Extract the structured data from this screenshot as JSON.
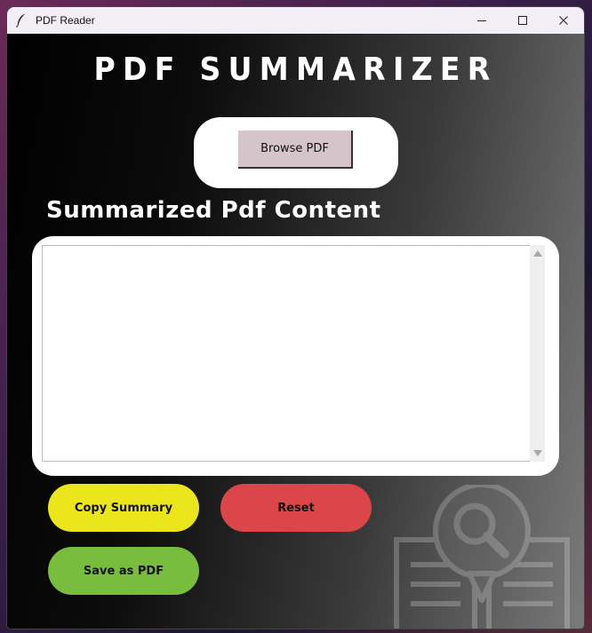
{
  "window": {
    "title": "PDF Reader",
    "app_icon": "feather-icon",
    "controls": [
      "minimize-icon",
      "maximize-icon",
      "close-icon"
    ]
  },
  "header": {
    "title": "PDF SUMMARIZER"
  },
  "browse": {
    "label": "Browse PDF"
  },
  "summary": {
    "heading": "Summarized Pdf Content",
    "value": ""
  },
  "actions": {
    "copy_label": "Copy Summary",
    "reset_label": "Reset",
    "save_label": "Save as PDF"
  },
  "colors": {
    "browse_button": "#d5c4c9",
    "copy_button": "#ebe61b",
    "reset_button": "#da4649",
    "save_button": "#78bd3e"
  },
  "decoration": {
    "icon": "document-search-icon"
  }
}
